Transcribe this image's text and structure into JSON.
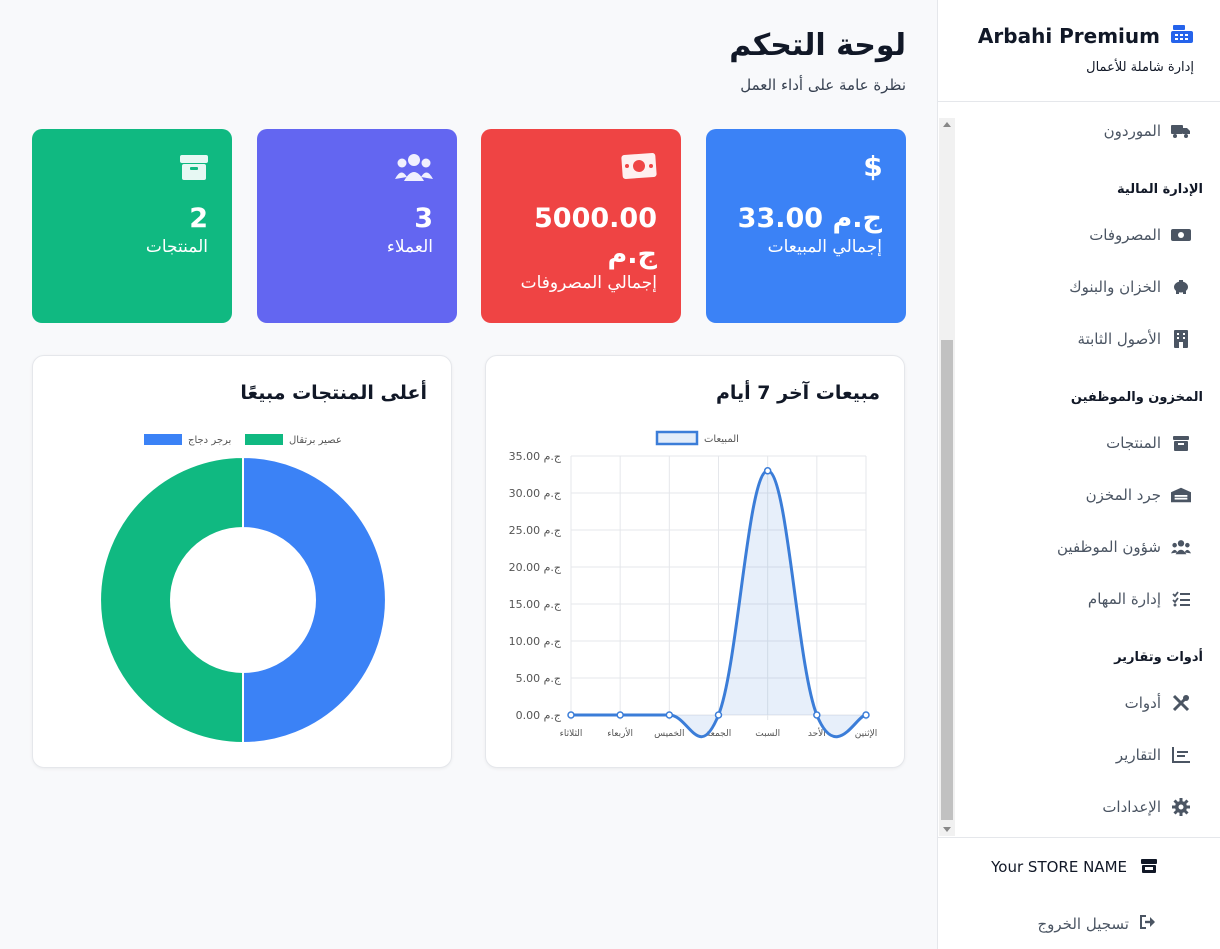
{
  "brand": {
    "name": "Arbahi Premium",
    "tagline": "إدارة شاملة للأعمال",
    "icon": "cash-register-icon"
  },
  "sidebar": {
    "items": [
      {
        "label": "الموردون",
        "icon": "truck-icon"
      },
      {
        "section": "الإدارة المالية"
      },
      {
        "label": "المصروفات",
        "icon": "money-bill-icon"
      },
      {
        "label": "الخزان والبنوك",
        "icon": "piggy-bank-icon"
      },
      {
        "label": "الأصول الثابتة",
        "icon": "building-icon"
      },
      {
        "section": "المخزون والموظفين"
      },
      {
        "label": "المنتجات",
        "icon": "box-icon"
      },
      {
        "label": "جرد المخزن",
        "icon": "warehouse-icon"
      },
      {
        "label": "شؤون الموظفين",
        "icon": "users-icon"
      },
      {
        "label": "إدارة المهام",
        "icon": "tasks-icon"
      },
      {
        "section": "أدوات وتقارير"
      },
      {
        "label": "أدوات",
        "icon": "tools-icon"
      },
      {
        "label": "التقارير",
        "icon": "chart-icon"
      },
      {
        "label": "الإعدادات",
        "icon": "gear-icon"
      }
    ]
  },
  "store": {
    "name": "Your STORE NAME",
    "icon": "store-icon"
  },
  "logout": {
    "label": "تسجيل الخروج",
    "icon": "sign-out-icon"
  },
  "header": {
    "title": "لوحة التحكم",
    "subtitle": "نظرة عامة على أداء العمل"
  },
  "cards": [
    {
      "value": "33.00 ج.م",
      "label": "إجمالي المبيعات",
      "color": "#3b82f6",
      "icon": "dollar-icon"
    },
    {
      "value": "5000.00 ج.م",
      "label": "إجمالي المصروفات",
      "color": "#ef4444",
      "icon": "money-bill-icon"
    },
    {
      "value": "3",
      "label": "العملاء",
      "color": "#6366f1",
      "icon": "users-icon"
    },
    {
      "value": "2",
      "label": "المنتجات",
      "color": "#10b981",
      "icon": "box-icon"
    }
  ],
  "charts": {
    "sales_title": "مبيعات آخر 7 أيام",
    "products_title": "أعلى المنتجات مبيعًا"
  },
  "chart_data": [
    {
      "type": "line",
      "title": "مبيعات آخر 7 أيام",
      "categories": [
        "الإثنين",
        "الأحد",
        "السبت",
        "الجمعة",
        "الخميس",
        "الأربعاء",
        "الثلاثاء"
      ],
      "series": [
        {
          "name": "المبيعات",
          "values": [
            0,
            0,
            33,
            0,
            0,
            0,
            0
          ]
        }
      ],
      "ylim": [
        0,
        35
      ],
      "yticks": [
        "ج.م 0.00",
        "ج.م 5.00",
        "ج.م 10.00",
        "ج.م 15.00",
        "ج.م 20.00",
        "ج.م 25.00",
        "ج.م 30.00",
        "ج.م 35.00"
      ],
      "x_direction": "right-to-left",
      "color": "#3b7dd8",
      "legend": "top",
      "grid": true
    },
    {
      "type": "pie",
      "title": "أعلى المنتجات مبيعًا",
      "labels": [
        "عصير برتقال",
        "برجر دجاج"
      ],
      "values": [
        1,
        1
      ],
      "colors": [
        "#10b981",
        "#3b82f6"
      ],
      "legend": "top",
      "donut": true
    }
  ]
}
